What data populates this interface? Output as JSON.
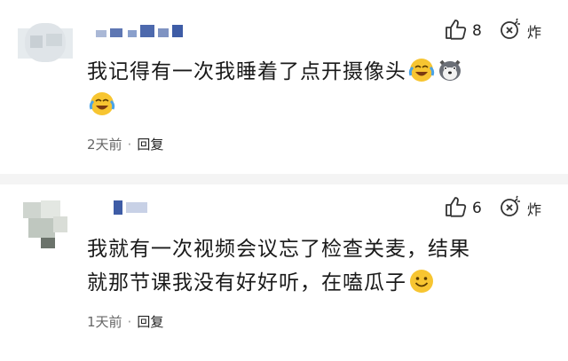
{
  "comments": [
    {
      "likes": "8",
      "bomb_label": "炸",
      "text": "我记得有一次我睡着了点开摄像头",
      "emojis": [
        "laugh-cry-emoji",
        "husky-dog-emoji",
        "laugh-cry-emoji"
      ],
      "time": "2天前",
      "separator": "·",
      "reply_label": "回复"
    },
    {
      "likes": "6",
      "bomb_label": "炸",
      "text_line1": "我就有一次视频会议忘了检查关麦，结果",
      "text_line2": "就那节课我没有好好听，在嗑瓜子",
      "emojis": [
        "smile-emoji"
      ],
      "time": "1天前",
      "separator": "·",
      "reply_label": "回复"
    }
  ],
  "colors": {
    "meta": "#666666",
    "text": "#1a1a1a",
    "divider": "#f4f4f4"
  }
}
